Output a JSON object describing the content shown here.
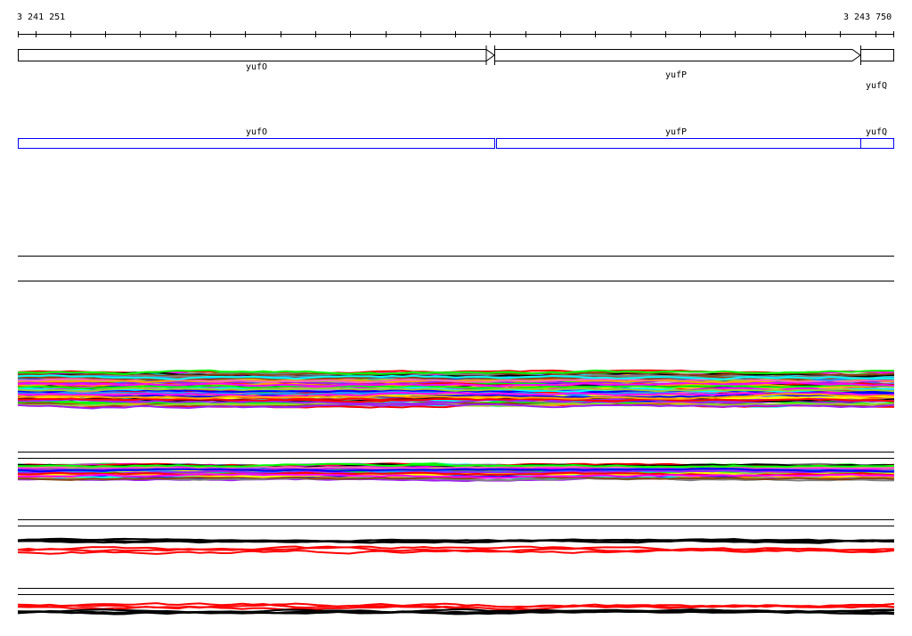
{
  "ruler": {
    "start_label": "3 241 251",
    "end_label": "3 243 750"
  },
  "genes": [
    {
      "name": "yufO",
      "strand": "+"
    },
    {
      "name": "yufP",
      "strand": "+"
    },
    {
      "name": "yufQ",
      "strand": "+"
    }
  ],
  "annotation_track": {
    "labels": [
      "yufO",
      "yufP",
      "yufQ"
    ],
    "color": "#0000ff"
  },
  "signal_colors": [
    "#ff0000",
    "#00ff00",
    "#0000ff",
    "#ff00ff",
    "#00ffff",
    "#ffa500",
    "#000000",
    "#808080",
    "#ff69b4",
    "#9acd32",
    "#1e90ff",
    "#8b4513",
    "#a020f0",
    "#ffff00"
  ],
  "tracks_colors": {
    "red": "#ff0000",
    "black": "#000000"
  }
}
